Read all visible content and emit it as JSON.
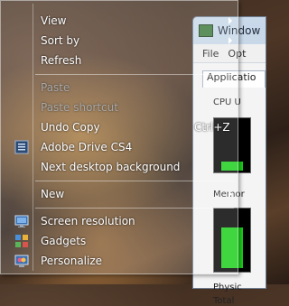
{
  "background_window": {
    "title": "Window",
    "menu": [
      "File",
      "Opt"
    ],
    "tab": "Applicatio",
    "cpu_label": "CPU U",
    "memory_label": "Memor",
    "physical_label": "Physic",
    "total_label": "Total"
  },
  "context_menu": {
    "view": "View",
    "sort_by": "Sort by",
    "refresh": "Refresh",
    "paste": "Paste",
    "paste_shortcut": "Paste shortcut",
    "undo_copy": "Undo Copy",
    "undo_copy_shortcut": "Ctrl+Z",
    "adobe_drive": "Adobe Drive CS4",
    "next_background": "Next desktop background",
    "new": "New",
    "screen_resolution": "Screen resolution",
    "gadgets": "Gadgets",
    "personalize": "Personalize"
  },
  "icons": {
    "adobe_drive": "adobe-drive-icon",
    "screen_resolution": "display-icon",
    "gadgets": "gadgets-icon",
    "personalize": "personalize-icon"
  }
}
